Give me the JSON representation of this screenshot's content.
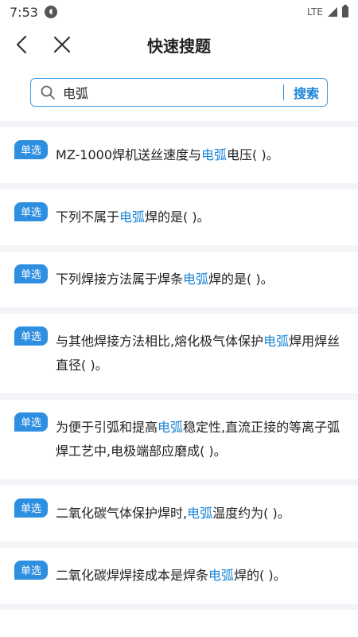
{
  "status_bar": {
    "time": "7:53",
    "network": "LTE"
  },
  "header": {
    "title": "快速搜题"
  },
  "search": {
    "value": "电弧",
    "button_label": "搜索"
  },
  "questions": [
    {
      "badge": "单选",
      "before": "MZ-1000焊机送丝速度与",
      "highlight": "电弧",
      "after": "电压( )。"
    },
    {
      "badge": "单选",
      "before": "下列不属于",
      "highlight": "电弧",
      "after": "焊的是( )。"
    },
    {
      "badge": "单选",
      "before": "下列焊接方法属于焊条",
      "highlight": "电弧",
      "after": "焊的是( )。"
    },
    {
      "badge": "单选",
      "before": "与其他焊接方法相比,熔化极气体保护",
      "highlight": "电弧",
      "after": "焊用焊丝直径( )。"
    },
    {
      "badge": "单选",
      "before": "为便于引弧和提高",
      "highlight": "电弧",
      "after": "稳定性,直流正接的等离子弧焊工艺中,电极端部应磨成( )。"
    },
    {
      "badge": "单选",
      "before": "二氧化碳气体保护焊时,",
      "highlight": "电弧",
      "after": "温度约为( )。"
    },
    {
      "badge": "单选",
      "before": "二氧化碳焊焊接成本是焊条",
      "highlight": "电弧",
      "after": "焊的( )。"
    }
  ],
  "colors": {
    "accent": "#1a85d6",
    "badge": "#2e8fe0",
    "separator": "#f3f4f7"
  }
}
